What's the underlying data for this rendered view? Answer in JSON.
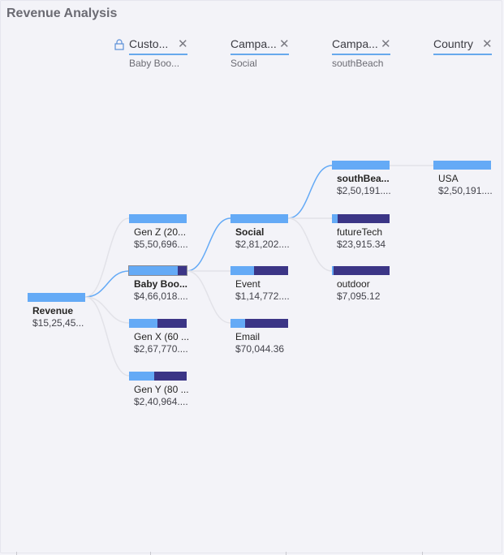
{
  "title": "Revenue Analysis",
  "colors": {
    "accent": "#64aaf6",
    "remainder": "#3b3586",
    "link_active": "#64aaf6",
    "link_inactive": "#e2e2e8"
  },
  "headers": [
    {
      "label": "Custo...",
      "subtitle": "Baby Boo...",
      "locked": true
    },
    {
      "label": "Campa...",
      "subtitle": "Social",
      "locked": false
    },
    {
      "label": "Campa...",
      "subtitle": "southBeach",
      "locked": false
    },
    {
      "label": "Country",
      "subtitle": "",
      "locked": false
    }
  ],
  "root": {
    "label": "Revenue",
    "value": "$15,25,45...",
    "share": 1.0
  },
  "level1": [
    {
      "label": "Gen Z (20...",
      "value": "$5,50,696....",
      "share": 1.0,
      "selected": false
    },
    {
      "label": "Baby Boo...",
      "value": "$4,66,018....",
      "share": 0.85,
      "selected": true
    },
    {
      "label": "Gen X (60 ...",
      "value": "$2,67,770....",
      "share": 0.49,
      "selected": false
    },
    {
      "label": "Gen Y (80 ...",
      "value": "$2,40,964....",
      "share": 0.44,
      "selected": false
    }
  ],
  "level2": [
    {
      "label": "Social",
      "value": "$2,81,202....",
      "share": 1.0,
      "selected": true
    },
    {
      "label": "Event",
      "value": "$1,14,772....",
      "share": 0.41,
      "selected": false
    },
    {
      "label": "Email",
      "value": "$70,044.36",
      "share": 0.25,
      "selected": false
    }
  ],
  "level3": [
    {
      "label": "southBea...",
      "value": "$2,50,191....",
      "share": 1.0,
      "selected": true
    },
    {
      "label": "futureTech",
      "value": "$23,915.34",
      "share": 0.1,
      "selected": false
    },
    {
      "label": "outdoor",
      "value": "$7,095.12",
      "share": 0.03,
      "selected": false
    }
  ],
  "level4": [
    {
      "label": "USA",
      "value": "$2,50,191....",
      "share": 1.0,
      "selected": false
    }
  ]
}
